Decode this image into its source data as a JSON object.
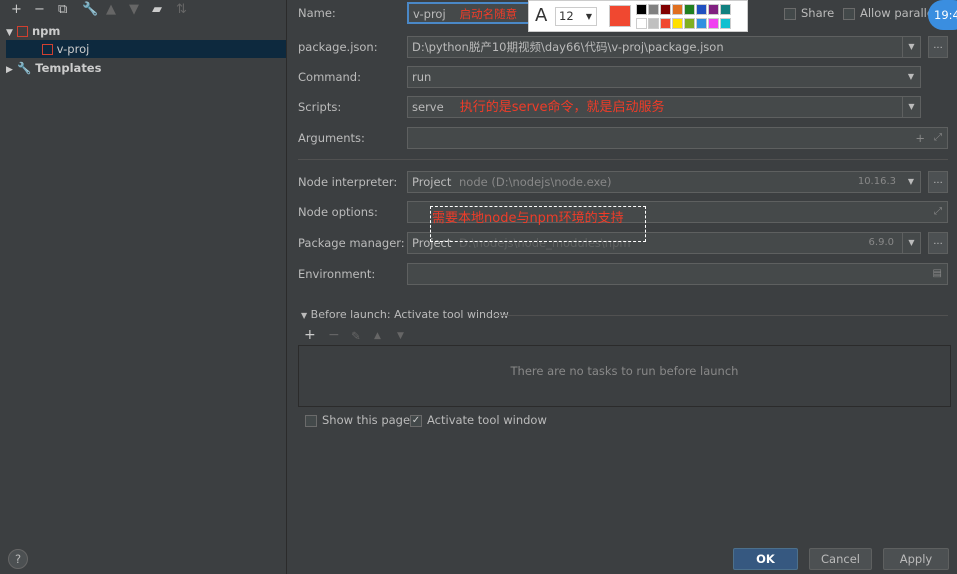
{
  "toolbar": {
    "icons": [
      "plus-icon",
      "minus-icon",
      "copy-icon",
      "wrench-icon",
      "arrow-up-icon",
      "arrow-down-icon",
      "folder-add-icon",
      "sort-icon"
    ]
  },
  "tree": {
    "npm": "npm",
    "item": "v-proj",
    "templates": "Templates"
  },
  "form": {
    "name_label": "Name:",
    "name_value": "v-proj",
    "name_note": "启动名随意",
    "share": "Share",
    "allow_parallel": "Allow paralle",
    "package_label": "package.json:",
    "package_value": "D:\\python脱产10期视频\\day66\\代码\\v-proj\\package.json",
    "command_label": "Command:",
    "command_value": "run",
    "scripts_label": "Scripts:",
    "scripts_value": "serve",
    "scripts_note": "执行的是serve命令，就是启动服务",
    "arguments_label": "Arguments:",
    "interpreter_label": "Node interpreter:",
    "interpreter_project": "Project",
    "interpreter_path": "node (D:\\nodejs\\node.exe)",
    "interpreter_version": "10.16.3",
    "options_label": "Node options:",
    "options_note": "需要本地node与npm环境的支持",
    "pm_label": "Package manager:",
    "pm_project": "Project",
    "pm_path": "D:\\nodejs\\node_modules\\npm",
    "pm_version": "6.9.0",
    "env_label": "Environment:",
    "before_launch": "Before launch: Activate tool window",
    "no_tasks": "There are no tasks to run before launch",
    "show_page": "Show this page",
    "activate_tool": "Activate tool window"
  },
  "annot_toolbar": {
    "font_size": "12",
    "current_color": "#f04830",
    "palette": [
      "#000000",
      "#808080",
      "#800000",
      "#e07020",
      "#208020",
      "#2050c0",
      "#802080",
      "#108080",
      "#ffffff",
      "#c0c0c0",
      "#f04830",
      "#ffe000",
      "#80b020",
      "#3090e0",
      "#f040f0",
      "#10c0d0"
    ]
  },
  "clock": "19:4",
  "buttons": {
    "ok": "OK",
    "cancel": "Cancel",
    "apply": "Apply",
    "help": "?"
  }
}
